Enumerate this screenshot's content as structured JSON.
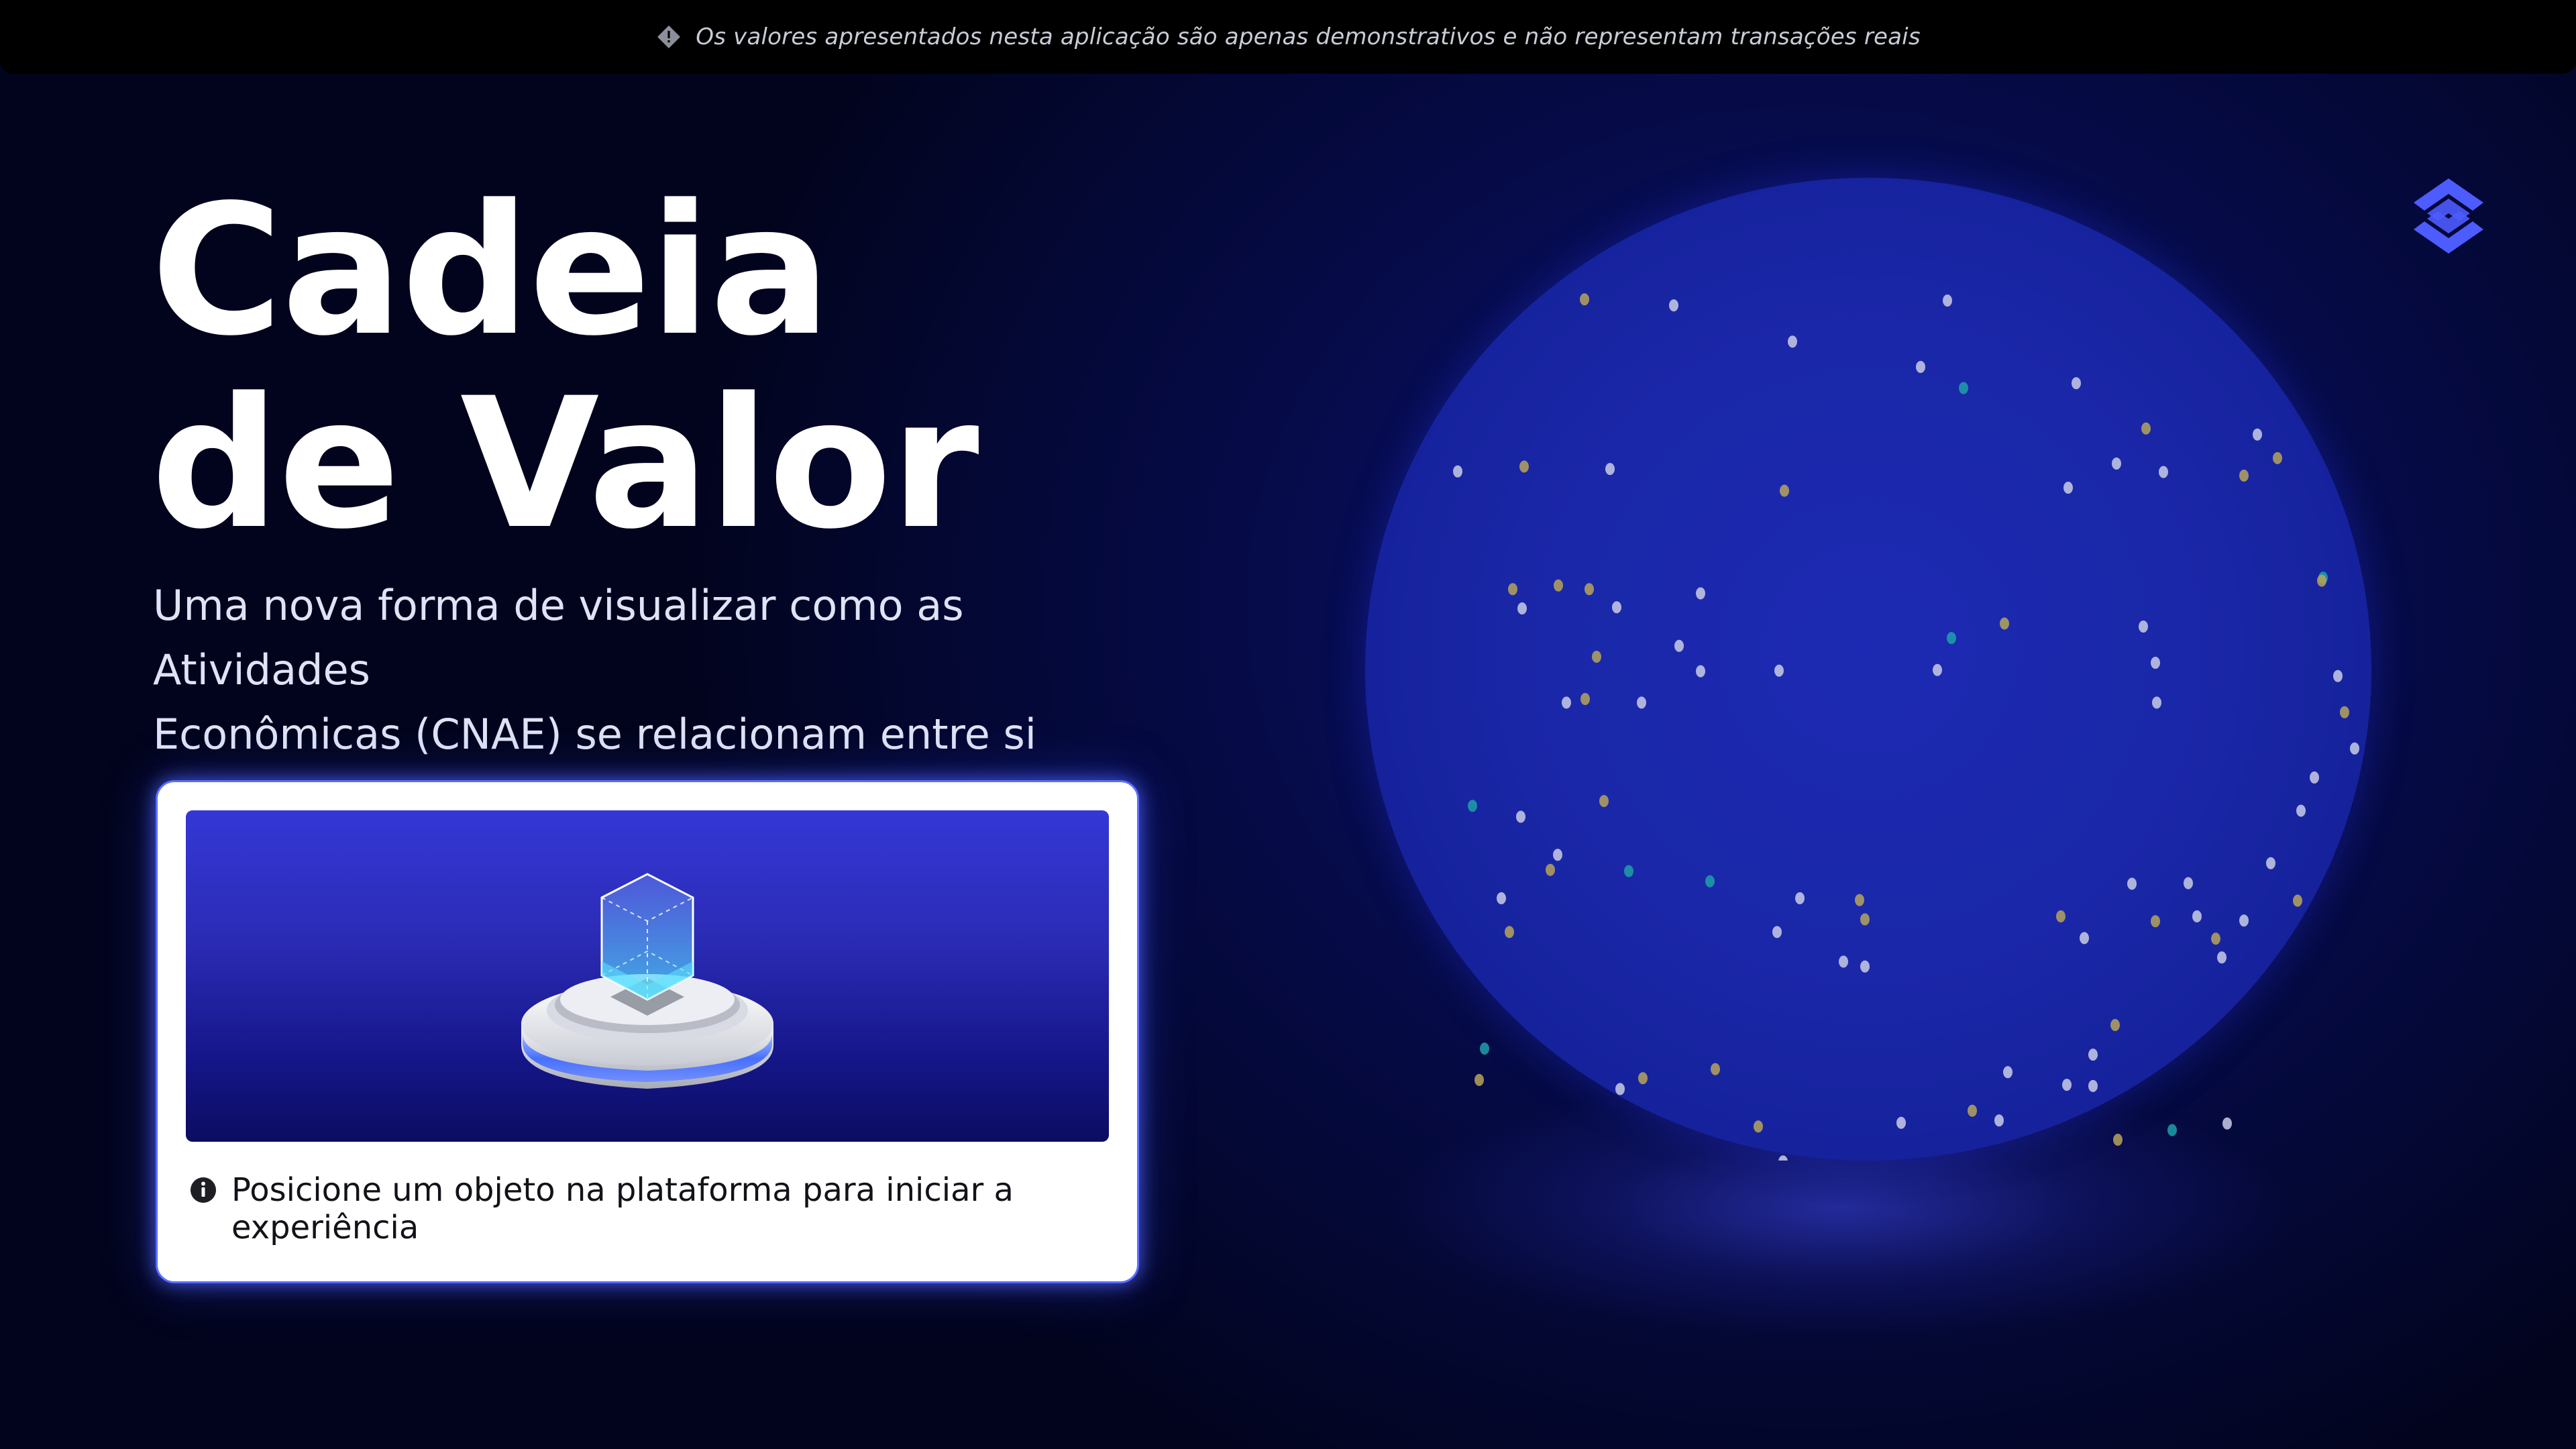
{
  "notice": {
    "icon": "warning-diamond-icon",
    "text": "Os valores apresentados nesta aplicação são apenas demonstrativos e não representam transações reais"
  },
  "hero": {
    "title_line1": "Cadeia",
    "title_line2": "de Valor",
    "subtitle_line1": "Uma nova forma de visualizar como as Atividades",
    "subtitle_line2": "Econômicas (CNAE) se relacionam entre si"
  },
  "card": {
    "illustration": "platform-with-cube-illustration",
    "info_icon": "info-icon",
    "hint": "Posicione um objeto na plataforma para iniciar a experiência"
  },
  "brand": {
    "logo": "banco-do-brasil-logo"
  },
  "colors": {
    "background": "#040837",
    "globe": "#1a27a8",
    "accent": "#4a5cff",
    "card_banner": "#2a2bb4",
    "node_white": "#c9cde6",
    "node_gold": "#b7a55a",
    "node_teal": "#1fa0a8",
    "node_red": "#c0506a",
    "node_green": "#1c8a2e"
  }
}
